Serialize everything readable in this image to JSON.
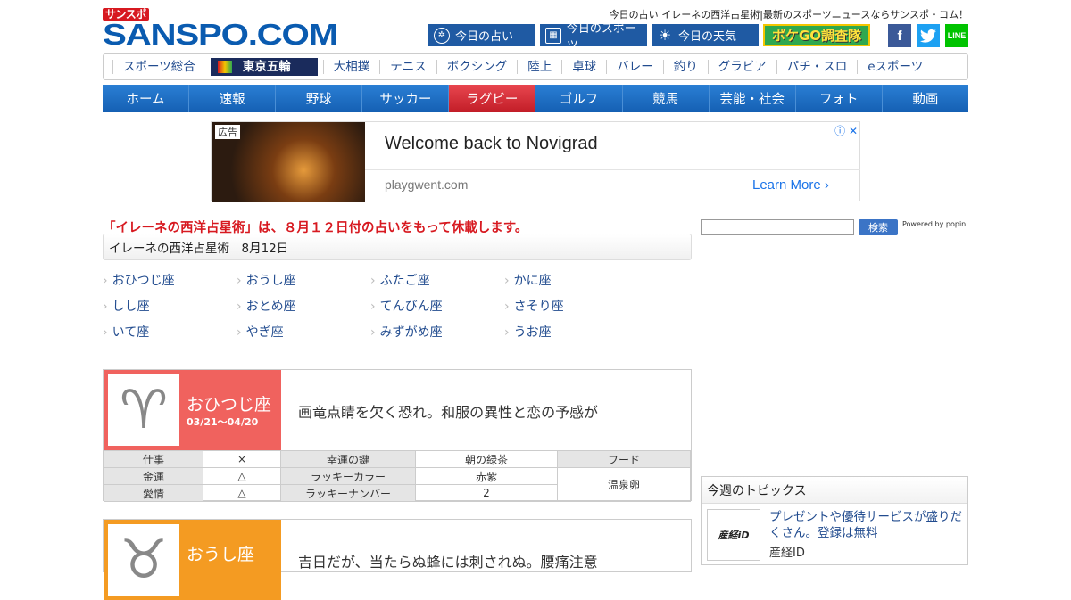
{
  "header": {
    "logo_small": "サンスポ",
    "logo_main": "SANSPO.COM",
    "tagline": "今日の占い|イレーネの西洋占星術|最新のスポーツニュースならサンスポ・コム！",
    "buttons": [
      {
        "label": "今日の占い",
        "icon": "horoscope-icon"
      },
      {
        "label": "今日のスポーツ",
        "icon": "calendar-icon"
      },
      {
        "label": "今日の天気",
        "icon": "sun-icon"
      }
    ],
    "pokego": "ポケGO調査隊",
    "sns": {
      "facebook": "f",
      "line": "LINE"
    }
  },
  "subnav": [
    "スポーツ総合",
    "東京五輪",
    "大相撲",
    "テニス",
    "ボクシング",
    "陸上",
    "卓球",
    "バレー",
    "釣り",
    "グラビア",
    "パチ・スロ",
    "eスポーツ"
  ],
  "mainnav": [
    "ホーム",
    "速報",
    "野球",
    "サッカー",
    "ラグビー",
    "ゴルフ",
    "競馬",
    "芸能・社会",
    "フォト",
    "動画"
  ],
  "ad": {
    "tag": "広告",
    "title": "Welcome back to Novigrad",
    "url": "playgwent.com",
    "cta": "Learn More"
  },
  "notice": "「イレーネの西洋占星術」は、８月１２日付の占いをもって休載します。",
  "page_title": "イレーネの西洋占星術　8月12日",
  "signs": [
    "おひつじ座",
    "おうし座",
    "ふたご座",
    "かに座",
    "しし座",
    "おとめ座",
    "てんびん座",
    "さそり座",
    "いて座",
    "やぎ座",
    "みずがめ座",
    "うお座"
  ],
  "cards": [
    {
      "name": "おひつじ座",
      "dates": "03/21～04/20",
      "glyph": "♈",
      "color": "#f0625e",
      "message": "画竜点睛を欠く恐れ。和服の異性と恋の予感が",
      "table": {
        "work_label": "仕事",
        "work": "×",
        "money_label": "金運",
        "money": "△",
        "love_label": "愛情",
        "love": "△",
        "key_label": "幸運の鍵",
        "key": "朝の緑茶",
        "color_label": "ラッキーカラー",
        "lucky_color": "赤紫",
        "number_label": "ラッキーナンバー",
        "number": "2",
        "food_label": "フード",
        "food": "温泉卵"
      }
    },
    {
      "name": "おうし座",
      "glyph": "♉",
      "color": "#f49b22",
      "message": "吉日だが、当たらぬ蜂には刺されぬ。腰痛注意"
    }
  ],
  "sidebar": {
    "search_button": "検索",
    "popin": "Powered by popin",
    "topics_title": "今週のトピックス",
    "topic_logo": "産経iD",
    "topic_text": "プレゼントや優待サービスが盛りだくさん。登録は無料",
    "topic_source": "産経ID"
  }
}
